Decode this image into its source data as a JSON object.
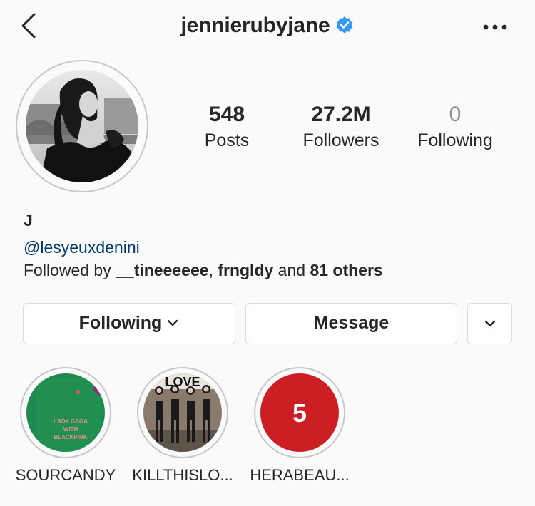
{
  "header": {
    "username": "jennierubyjane",
    "verified": true,
    "icons": {
      "back": "chevron-left-icon",
      "verified": "verified-badge-icon",
      "more": "more-horizontal-icon"
    }
  },
  "stats": [
    {
      "value": "548",
      "label": "Posts"
    },
    {
      "value": "27.2M",
      "label": "Followers"
    },
    {
      "value": "0",
      "label": "Following"
    }
  ],
  "bio": {
    "name": "J",
    "link": "@lesyeuxdenini",
    "followed_prefix": "Followed by ",
    "followed_user1": "__tineeeeee",
    "followed_sep": ", ",
    "followed_user2": "frngldy",
    "followed_and": " and ",
    "followed_others": "81 others"
  },
  "actions": {
    "following_label": "Following",
    "message_label": "Message"
  },
  "highlights": [
    {
      "label": "SOURCANDY",
      "cover_text": "LADY GAGA WITH BLACKPINK"
    },
    {
      "label": "KILLTHISLO...",
      "cover_text": "LOVE"
    },
    {
      "label": "HERABEAU...",
      "cover_text": "5"
    }
  ],
  "colors": {
    "link": "#00376b",
    "verified": "#3897f0",
    "highlight_green": "#1f8a4e",
    "highlight_red": "#cc1f24"
  }
}
